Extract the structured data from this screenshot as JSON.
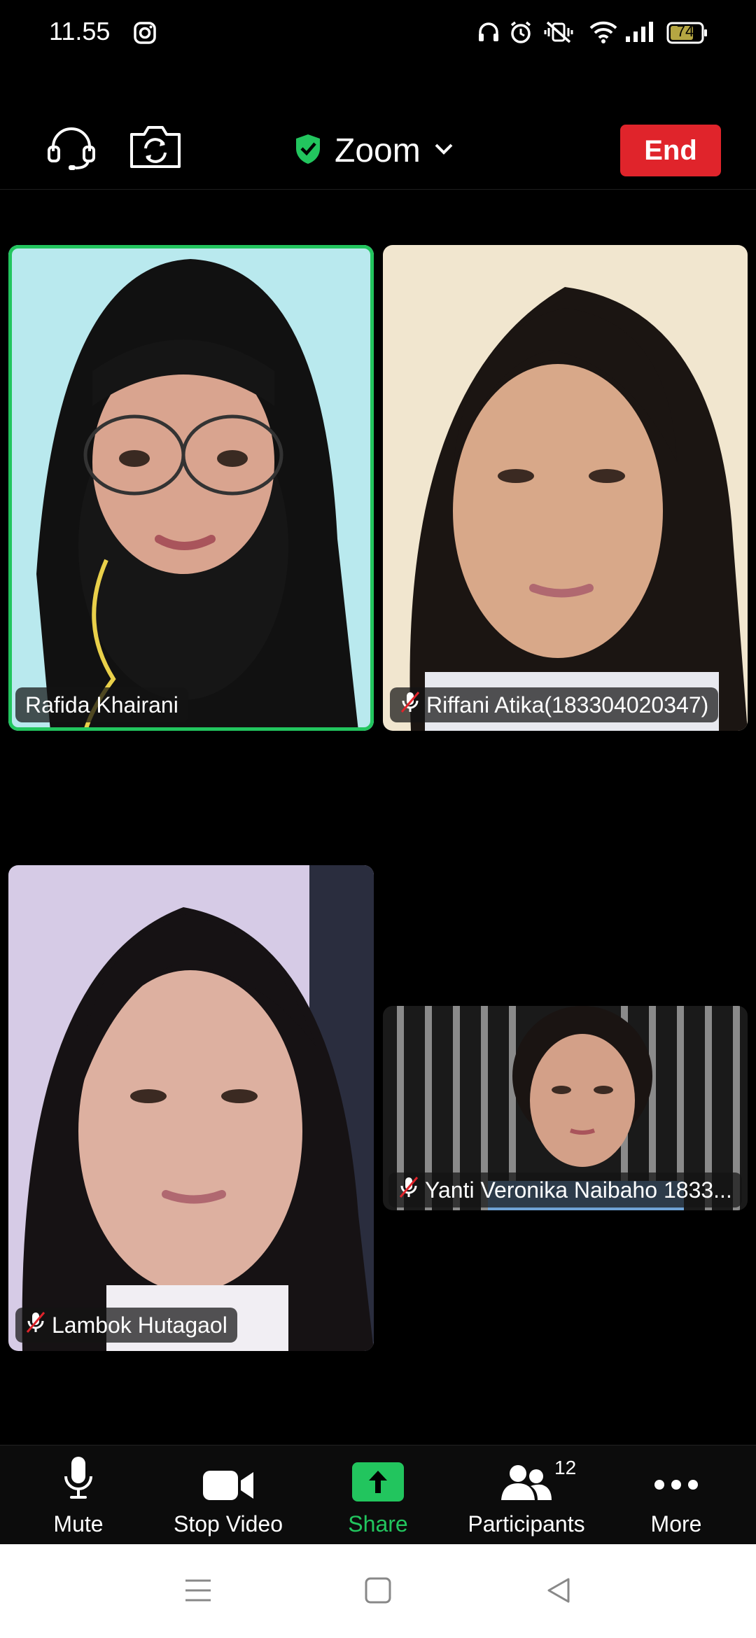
{
  "status_bar": {
    "time": "11.55",
    "battery": "74",
    "icons": [
      "instagram-icon",
      "headphones-icon",
      "alarm-icon",
      "vibrate-off-icon",
      "wifi-icon",
      "signal-icon",
      "battery-icon"
    ]
  },
  "header": {
    "app_title": "Zoom",
    "end_label": "End",
    "colors": {
      "end": "#e0242b",
      "shield": "#22c55e"
    }
  },
  "participants_tiles": [
    {
      "name": "Rafida Khairani",
      "muted": false,
      "active_speaker": true
    },
    {
      "name": "Riffani Atika(183304020347)",
      "muted": true,
      "active_speaker": false
    },
    {
      "name": "Lambok Hutagaol",
      "muted": true,
      "active_speaker": false
    },
    {
      "name": "Yanti Veronika Naibaho 1833...",
      "muted": true,
      "active_speaker": false
    }
  ],
  "toolbar": {
    "mute_label": "Mute",
    "video_label": "Stop Video",
    "share_label": "Share",
    "participants_label": "Participants",
    "participants_count": "12",
    "more_label": "More",
    "colors": {
      "share": "#22c55e"
    }
  },
  "nav": {
    "icons": [
      "menu-icon",
      "home-square-icon",
      "back-triangle-icon"
    ]
  }
}
